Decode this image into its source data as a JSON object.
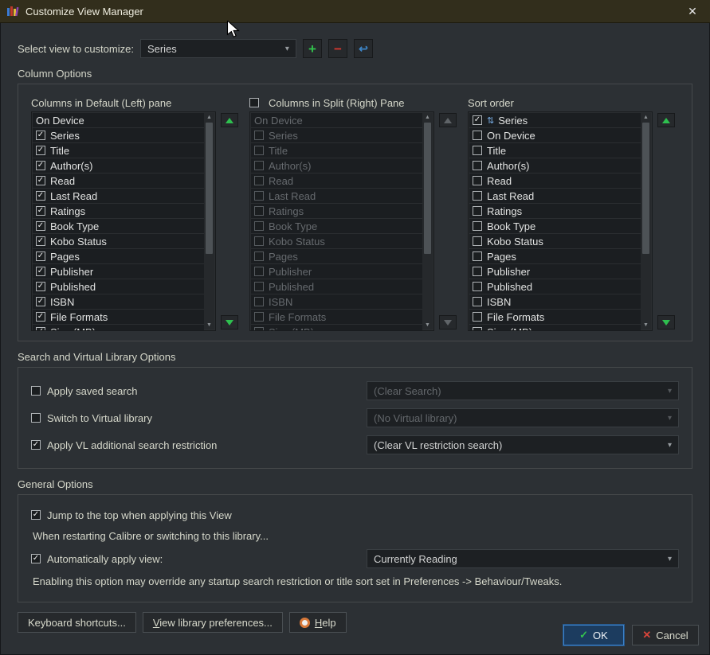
{
  "window": {
    "title": "Customize View Manager",
    "close_glyph": "✕"
  },
  "toolbar": {
    "label": "Select view to customize:",
    "selected_view": "Series",
    "add_glyph": "+",
    "remove_glyph": "−",
    "rename_glyph": "↩"
  },
  "sections": {
    "column_options": "Column Options",
    "search_vl": "Search and Virtual Library Options",
    "general": "General Options"
  },
  "panes": {
    "left": {
      "header": "Columns in Default (Left) pane",
      "items": [
        {
          "label": "On Device"
        },
        {
          "label": "Series",
          "checked": true
        },
        {
          "label": "Title",
          "checked": true
        },
        {
          "label": "Author(s)",
          "checked": true
        },
        {
          "label": "Read",
          "checked": true
        },
        {
          "label": "Last Read",
          "checked": true
        },
        {
          "label": "Ratings",
          "checked": true
        },
        {
          "label": "Book Type",
          "checked": true
        },
        {
          "label": "Kobo Status",
          "checked": true
        },
        {
          "label": "Pages",
          "checked": true
        },
        {
          "label": "Publisher",
          "checked": true
        },
        {
          "label": "Published",
          "checked": true
        },
        {
          "label": "ISBN",
          "checked": true
        },
        {
          "label": "File Formats",
          "checked": true
        },
        {
          "label": "Size (MB)",
          "checked": true
        }
      ]
    },
    "split": {
      "header": "Columns in Split (Right) Pane",
      "header_checked": false,
      "items": [
        {
          "label": "On Device",
          "disabled": true
        },
        {
          "label": "Series",
          "checked": false,
          "disabled": true
        },
        {
          "label": "Title",
          "checked": false,
          "disabled": true
        },
        {
          "label": "Author(s)",
          "checked": false,
          "disabled": true
        },
        {
          "label": "Read",
          "checked": false,
          "disabled": true
        },
        {
          "label": "Last Read",
          "checked": false,
          "disabled": true
        },
        {
          "label": "Ratings",
          "checked": false,
          "disabled": true
        },
        {
          "label": "Book Type",
          "checked": false,
          "disabled": true
        },
        {
          "label": "Kobo Status",
          "checked": false,
          "disabled": true
        },
        {
          "label": "Pages",
          "checked": false,
          "disabled": true
        },
        {
          "label": "Publisher",
          "checked": false,
          "disabled": true
        },
        {
          "label": "Published",
          "checked": false,
          "disabled": true
        },
        {
          "label": "ISBN",
          "checked": false,
          "disabled": true
        },
        {
          "label": "File Formats",
          "checked": false,
          "disabled": true
        },
        {
          "label": "Size (MB)",
          "checked": false,
          "disabled": true
        }
      ]
    },
    "sort": {
      "header": "Sort order",
      "items": [
        {
          "label": "Series",
          "checked": true,
          "sort_icon": true
        },
        {
          "label": "On Device",
          "checked": false
        },
        {
          "label": "Title",
          "checked": false
        },
        {
          "label": "Author(s)",
          "checked": false
        },
        {
          "label": "Read",
          "checked": false
        },
        {
          "label": "Last Read",
          "checked": false
        },
        {
          "label": "Ratings",
          "checked": false
        },
        {
          "label": "Book Type",
          "checked": false
        },
        {
          "label": "Kobo Status",
          "checked": false
        },
        {
          "label": "Pages",
          "checked": false
        },
        {
          "label": "Publisher",
          "checked": false
        },
        {
          "label": "Published",
          "checked": false
        },
        {
          "label": "ISBN",
          "checked": false
        },
        {
          "label": "File Formats",
          "checked": false
        },
        {
          "label": "Size (MB)",
          "checked": false
        }
      ]
    }
  },
  "search_options": {
    "rows": [
      {
        "label": "Apply saved search",
        "checked": false,
        "value": "(Clear Search)",
        "enabled": false
      },
      {
        "label": "Switch to Virtual library",
        "checked": false,
        "value": "(No Virtual library)",
        "enabled": false
      },
      {
        "label": "Apply VL additional search restriction",
        "checked": true,
        "value": "(Clear VL restriction search)",
        "enabled": true
      }
    ]
  },
  "general_options": {
    "jump_label": "Jump to the top when applying this View",
    "jump_checked": true,
    "restart_note": "When restarting Calibre or switching to this library...",
    "auto_label": "Automatically apply view:",
    "auto_checked": true,
    "auto_value": "Currently Reading",
    "warning": "Enabling this option may override any startup search restriction or title sort set in Preferences -> Behaviour/Tweaks."
  },
  "footer": {
    "keyboard": "Keyboard shortcuts...",
    "view_prefs_initial": "V",
    "view_prefs_rest": "iew library preferences...",
    "help_initial": "H",
    "help_rest": "elp",
    "ok": "OK",
    "cancel": "Cancel"
  }
}
